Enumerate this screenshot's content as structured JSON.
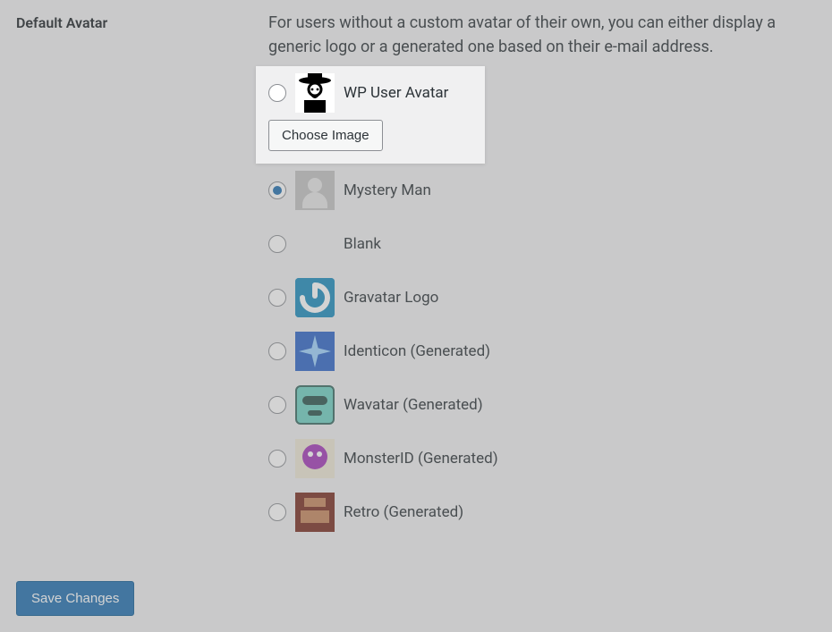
{
  "section_heading": "Default Avatar",
  "description": "For users without a custom avatar of their own, you can either display a generic logo or a generated one based on their e-mail address.",
  "choose_image_label": "Choose Image",
  "save_label": "Save Changes",
  "selected_option": "mystery",
  "options": {
    "wp": {
      "label": "WP User Avatar"
    },
    "mystery": {
      "label": "Mystery Man"
    },
    "blank": {
      "label": "Blank"
    },
    "gravatar": {
      "label": "Gravatar Logo"
    },
    "identicon": {
      "label": "Identicon (Generated)"
    },
    "wavatar": {
      "label": "Wavatar (Generated)"
    },
    "monster": {
      "label": "MonsterID (Generated)"
    },
    "retro": {
      "label": "Retro (Generated)"
    }
  }
}
